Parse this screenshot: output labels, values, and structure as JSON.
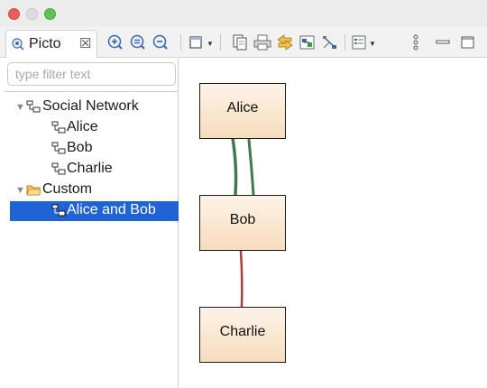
{
  "window": {
    "traffic_lights": [
      "close",
      "minimize",
      "zoom"
    ]
  },
  "tab": {
    "label": "Picto",
    "close_glyph": "☒",
    "icon": "picto-eye-icon"
  },
  "toolbar": {
    "buttons": [
      "zoom-in-icon",
      "zoom-reset-icon",
      "zoom-out-icon",
      "layout-menu-icon",
      "copy-icon",
      "print-icon",
      "refresh-icon",
      "export-icon",
      "filter-icon",
      "view-menu-icon",
      "more-menu-icon",
      "minimize-view-icon",
      "maximize-view-icon"
    ]
  },
  "filter": {
    "placeholder": "type filter text",
    "value": ""
  },
  "tree": {
    "social_network": {
      "label": "Social Network",
      "children": [
        "Alice",
        "Bob",
        "Charlie"
      ]
    },
    "custom": {
      "label": "Custom",
      "children": [
        "Alice and Bob"
      ]
    },
    "selected": "Alice and Bob"
  },
  "graph": {
    "nodes": [
      "Alice",
      "Bob",
      "Charlie"
    ],
    "edges": [
      {
        "from": "Alice",
        "to": "Bob",
        "color": "#3f7a4a"
      },
      {
        "from": "Alice",
        "to": "Bob",
        "color": "#3f7a4a"
      },
      {
        "from": "Bob",
        "to": "Charlie",
        "color": "#b23b3b"
      }
    ]
  },
  "colors": {
    "selection": "#1f63d6",
    "node_fill_top": "#fdf3e8",
    "node_fill_bottom": "#f8dcbd",
    "edge_positive": "#3f7a4a",
    "edge_negative": "#b23b3b"
  }
}
